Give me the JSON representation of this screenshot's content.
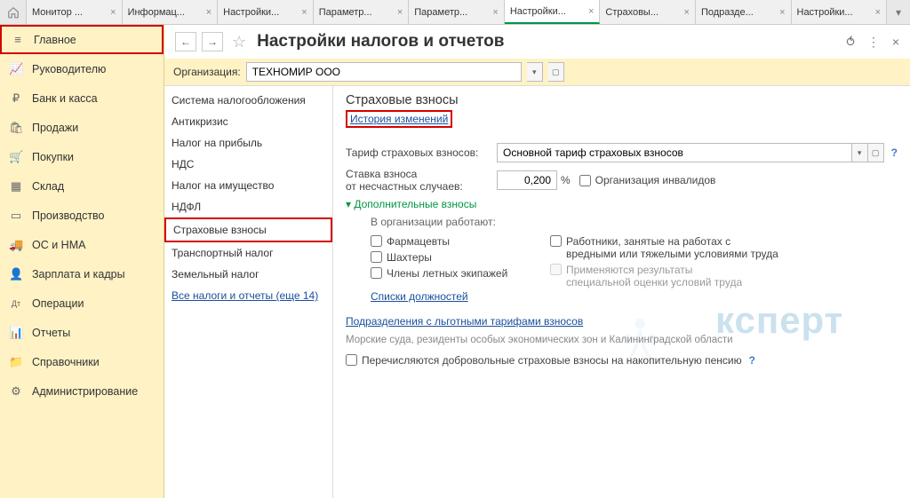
{
  "tabs": {
    "items": [
      {
        "label": "Монитор ..."
      },
      {
        "label": "Информац..."
      },
      {
        "label": "Настройки..."
      },
      {
        "label": "Параметр..."
      },
      {
        "label": "Параметр..."
      },
      {
        "label": "Настройки..."
      },
      {
        "label": "Страховы..."
      },
      {
        "label": "Подразде..."
      },
      {
        "label": "Настройки..."
      }
    ]
  },
  "sidebar": {
    "items": [
      {
        "icon": "≡",
        "label": "Главное"
      },
      {
        "icon": "📈",
        "label": "Руководителю"
      },
      {
        "icon": "₽",
        "label": "Банк и касса"
      },
      {
        "icon": "🛍",
        "label": "Продажи"
      },
      {
        "icon": "🛒",
        "label": "Покупки"
      },
      {
        "icon": "▦",
        "label": "Склад"
      },
      {
        "icon": "▭",
        "label": "Производство"
      },
      {
        "icon": "🚚",
        "label": "ОС и НМА"
      },
      {
        "icon": "👤",
        "label": "Зарплата и кадры"
      },
      {
        "icon": "Дт",
        "label": "Операции"
      },
      {
        "icon": "📊",
        "label": "Отчеты"
      },
      {
        "icon": "📁",
        "label": "Справочники"
      },
      {
        "icon": "⚙",
        "label": "Администрирование"
      }
    ]
  },
  "header": {
    "title": "Настройки налогов и отчетов"
  },
  "org": {
    "label": "Организация:",
    "value": "ТЕХНОМИР ООО"
  },
  "categories": [
    "Система налогообложения",
    "Антикризис",
    "Налог на прибыль",
    "НДС",
    "Налог на имущество",
    "НДФЛ",
    "Страховые взносы",
    "Транспортный налог",
    "Земельный налог",
    "Все налоги и отчеты (еще 14)"
  ],
  "form": {
    "section_title": "Страховые взносы",
    "history_link": "История изменений",
    "tarif_label": "Тариф страховых взносов:",
    "tarif_value": "Основной тариф страховых взносов",
    "rate_label_l1": "Ставка взноса",
    "rate_label_l2": "от несчастных случаев:",
    "rate_value": "0,200",
    "rate_unit": "%",
    "org_inv_label": "Организация инвалидов",
    "extra_label": "Дополнительные взносы",
    "works_label": "В организации работают:",
    "cb_pharm": "Фармацевты",
    "cb_miners": "Шахтеры",
    "cb_crew": "Члены летных экипажей",
    "positions_link": "Списки должностей",
    "cb_heavy_l1": "Работники, занятые на работах с",
    "cb_heavy_l2": "вредными или тяжелыми условиями труда",
    "cb_sout_l1": "Применяются результаты",
    "cb_sout_l2": "специальной оценки условий труда",
    "subdiv_link": "Подразделения с льготными тарифами взносов",
    "note_sea": "Морские суда, резиденты особых экономических зон и Калининградской области",
    "cb_volunt": "Перечисляются добровольные страховые взносы на накопительную пенсию"
  },
  "watermark": {
    "text": "ксперт",
    "eight": "8"
  }
}
